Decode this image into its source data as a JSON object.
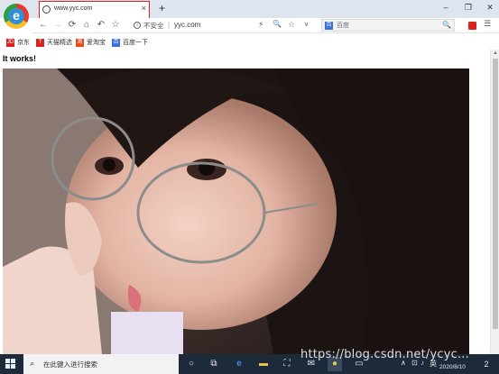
{
  "tab": {
    "title": "www.yyc.com",
    "close": "×",
    "new": "+"
  },
  "window": {
    "minimize": "–",
    "maximize": "❐",
    "close": "✕"
  },
  "nav": {
    "back": "←",
    "forward": "→",
    "reload": "⟳",
    "home": "⌂",
    "undo": "↶",
    "favorite": "☆"
  },
  "address": {
    "security_label": "不安全",
    "separator": "|",
    "url": "yyc.com",
    "lightning": "⚡",
    "zoom": "🔍",
    "star": "☆",
    "dropdown": "∨"
  },
  "search": {
    "placeholder": "百度",
    "engine_badge": "百",
    "magnifier": "🔍"
  },
  "bookmarks": [
    {
      "label": "京东",
      "icon": "JD",
      "color": "#d9231f"
    },
    {
      "label": "天猫精选",
      "icon": "T",
      "color": "#d9231f"
    },
    {
      "label": "爱淘宝",
      "icon": "淘",
      "color": "#e84b16"
    },
    {
      "label": "百度一下",
      "icon": "百",
      "color": "#3a6fe0"
    }
  ],
  "page": {
    "heading": "It works!"
  },
  "taskbar": {
    "search_placeholder": "在此键入进行搜索",
    "tray_input": "英",
    "date": "2020/8/10",
    "notifications": "2"
  },
  "watermark": "https://blog.csdn.net/ycyc..."
}
